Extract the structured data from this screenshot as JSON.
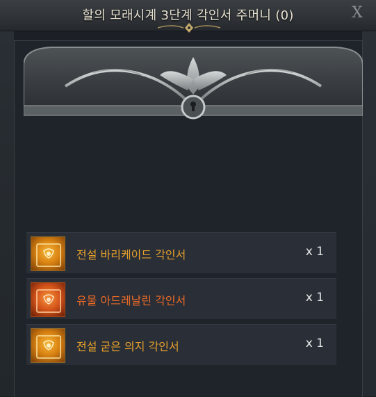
{
  "window": {
    "title": "할의 모래시계 3단계 각인서 주머니 (0)",
    "close_label": "X"
  },
  "items": [
    {
      "name": "전설 바리케이드 각인서",
      "quantity": "x 1",
      "grade": "legendary",
      "icon": "book-icon"
    },
    {
      "name": "유물 아드레날린 각인서",
      "quantity": "x 1",
      "grade": "relic",
      "icon": "book-icon"
    },
    {
      "name": "전설 굳은 의지 각인서",
      "quantity": "x 1",
      "grade": "legendary",
      "icon": "book-icon"
    }
  ],
  "colors": {
    "legendary": "#e7a02c",
    "relic": "#ee6a25"
  }
}
